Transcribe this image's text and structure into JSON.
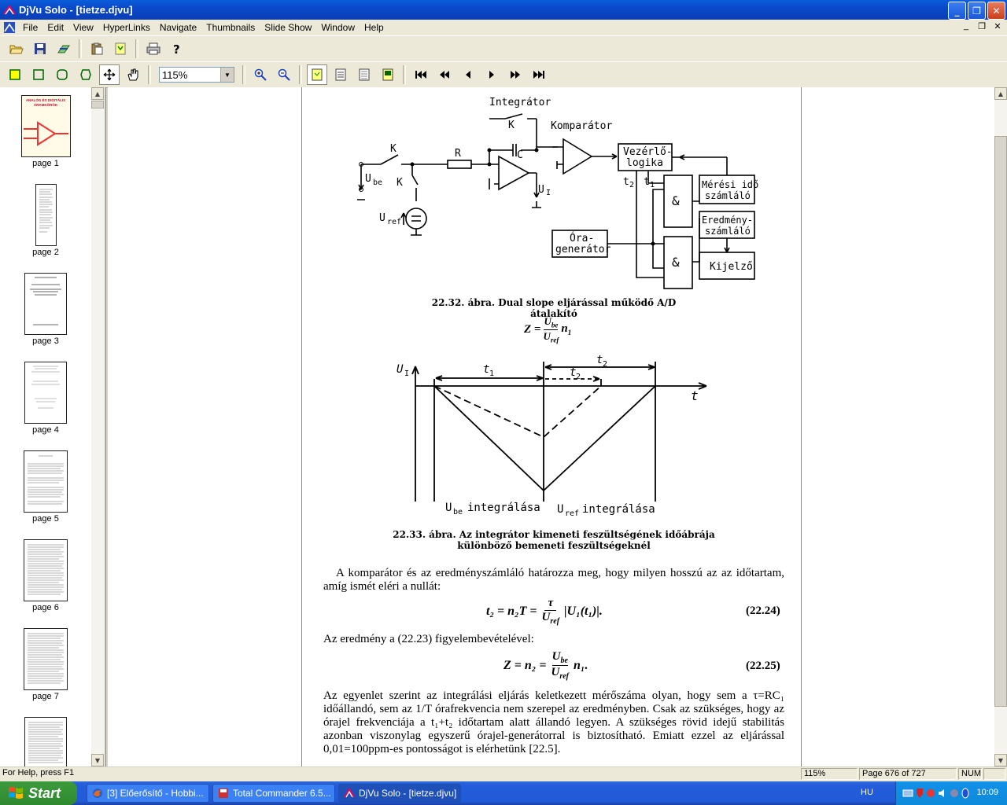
{
  "window": {
    "title": "DjVu Solo - [tietze.djvu]",
    "mdi_controls": [
      "_",
      "❐",
      "✕"
    ]
  },
  "menu": [
    "File",
    "Edit",
    "View",
    "HyperLinks",
    "Navigate",
    "Thumbnails",
    "Slide Show",
    "Window",
    "Help"
  ],
  "toolbar": {
    "zoom_value": "115%"
  },
  "thumbnails": [
    "page 1",
    "page 2",
    "page 3",
    "page 4",
    "page 5",
    "page 6",
    "page 7"
  ],
  "thumb1": {
    "title_line1": "ANALÓG ÉS DIGITÁLIS",
    "title_line2": "ÁRAMKÖRÖK"
  },
  "doc": {
    "fig1": {
      "caption": "22.32. ábra. Dual slope eljárással működő A/D átalakító",
      "labels": {
        "integrator": "Integrátor",
        "komparator": "Komparátor",
        "k1": "K",
        "k2": "K",
        "k3": "K",
        "r": "R",
        "ci": "C",
        "ube": "U",
        "be": "be",
        "uref": "U",
        "ref": "ref",
        "ui": "U",
        "i": "I",
        "vezerlo1": "Vezérlő-",
        "vezerlo2": "logika",
        "meresi1": "Mérési idő",
        "meresi2": "számláló",
        "eredmeny1": "Eredmény-",
        "eredmeny2": "számláló",
        "ora1": "Óra-",
        "ora2": "generátor",
        "kijelzo": "Kijelző",
        "and": "&",
        "t1": "t",
        "t2": "t",
        "sub1": "1",
        "sub2": "2",
        "z_eq": "Z =",
        "frac_top": "U",
        "frac_top_sub": "be",
        "frac_bot": "U",
        "frac_bot_sub": "ref",
        "n1": "n"
      }
    },
    "fig2": {
      "caption_line1": "22.33. ábra. Az integrátor kimeneti feszültségének időábrája",
      "caption_line2": "különböző bemeneti feszültségeknél",
      "ylabel": "U",
      "ylabel_sub": "I",
      "xlabel": "t",
      "t1": "t",
      "t2": "t",
      "t2b": "t",
      "lbl_left": "integrálása",
      "lbl_right": "integrálása",
      "ube": "U",
      "be": "be",
      "uref": "U",
      "ref": "ref"
    },
    "para1": "A komparátor és az eredményszámláló határozza meg, hogy milyen hosszú az az időtartam, amíg ismét eléri a nullát:",
    "eq1": {
      "lhs": "t₂ = n₂T =",
      "num": "τ",
      "den": "U",
      "den_sub": "ref",
      "rhs": "|U₁(t₁)|.",
      "number": "(22.24)"
    },
    "para2": "Az eredmény a (22.23) figyelembevételével:",
    "eq2": {
      "lhs": "Z = n₂ =",
      "num": "U",
      "num_sub": "be",
      "den": "U",
      "den_sub": "ref",
      "rhs": "n₁.",
      "number": "(22.25)"
    },
    "para3": "Az egyenlet szerint az integrálási eljárás keletkezett mérőszáma olyan, hogy sem a τ=RC₁ időállandó, sem az 1/T órafrekvencia nem szerepel az eredményben. Csak az szükséges, hogy az órajel frekvenciája a t₁+t₂ időtartam alatt állandó legyen. A szükséges rövid idejű stabilitás azonban viszonylag egyszerű órajel-generátorral is biztosítható. Emiatt ezzel az eljárással 0,01=100ppm-es pontosságot is elérhetünk [22.5]."
  },
  "status": {
    "help": "For Help, press F1",
    "zoom": "115%",
    "page": "Page 676 of 727",
    "num": "NUM"
  },
  "taskbar": {
    "start": "Start",
    "tasks": [
      "[3] Előerősítő - Hobbi...",
      "Total Commander 6.5...",
      "DjVu Solo - [tietze.djvu]"
    ],
    "lang": "HU",
    "clock": "10:09"
  },
  "colors": {
    "titlebar": "#0b49c9",
    "taskbar": "#245ddb",
    "start": "#3c9a3c",
    "chrome": "#ece9d8"
  }
}
